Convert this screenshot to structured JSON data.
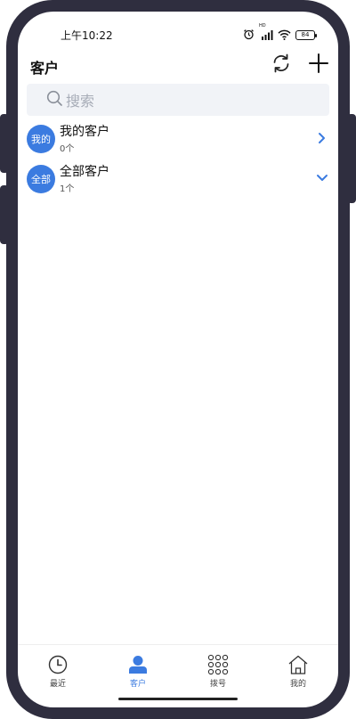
{
  "status_bar": {
    "time": "上午10:22",
    "hd_label": "HD",
    "battery": "84"
  },
  "header": {
    "title": "客户"
  },
  "search": {
    "placeholder": "搜索"
  },
  "groups": [
    {
      "avatar_text": "我的",
      "name": "我的客户",
      "count": "0个",
      "arrow": "chevron-right-icon"
    },
    {
      "avatar_text": "全部",
      "name": "全部客户",
      "count": "1个",
      "arrow": "chevron-down-icon"
    }
  ],
  "tabs": [
    {
      "label": "最近",
      "icon": "clock-icon",
      "active": false
    },
    {
      "label": "客户",
      "icon": "person-icon",
      "active": true
    },
    {
      "label": "拨号",
      "icon": "dialpad-icon",
      "active": false
    },
    {
      "label": "我的",
      "icon": "home-icon",
      "active": false
    }
  ],
  "colors": {
    "accent": "#3b7be0",
    "frame": "#2f2e3f",
    "search_bg": "#f1f3f7"
  }
}
